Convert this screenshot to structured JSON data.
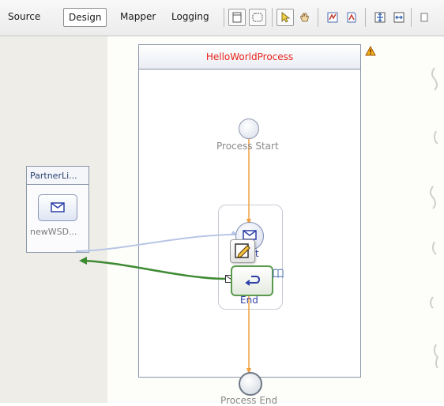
{
  "toolbar": {
    "tabs": [
      {
        "label": "Source",
        "active": false
      },
      {
        "label": "Design",
        "active": true
      },
      {
        "label": "Mapper",
        "active": false
      },
      {
        "label": "Logging",
        "active": false
      }
    ],
    "buttons": [
      {
        "icon": "select-frame-icon"
      },
      {
        "icon": "dashed-selection-icon"
      },
      {
        "icon": "pointer-arrow-icon"
      },
      {
        "icon": "hand-pan-icon"
      },
      {
        "icon": "validate-icon"
      },
      {
        "icon": "validate-document-icon"
      },
      {
        "icon": "fit-diagram-icon"
      },
      {
        "icon": "fit-width-icon"
      }
    ]
  },
  "diagram": {
    "process_title": "HelloWorldProcess",
    "warning_icon": "warning-triangle-icon",
    "partner_link": {
      "title": "PartnerLi...",
      "operation_label": "newWSD..."
    },
    "start_label": "Process Start",
    "receive_label_tail": "t",
    "reply_label": "End",
    "end_label": "Process End",
    "colors": {
      "process_title": "#e8251c",
      "flow_line": "#f0a040",
      "input_link": "#b8c6e6",
      "reply_link": "#3e8a33",
      "selected_border": "#5a9a4d"
    }
  }
}
